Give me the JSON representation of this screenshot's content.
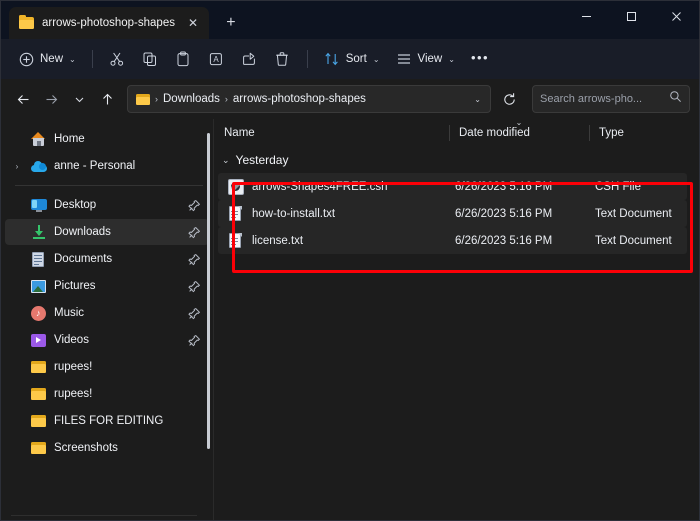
{
  "window": {
    "controls": {
      "minimize": "─",
      "maximize": "□",
      "close": "✕"
    }
  },
  "tabbar": {
    "tabs": [
      {
        "title": "arrows-photoshop-shapes",
        "close_label": "✕"
      }
    ],
    "new_tab_label": "+"
  },
  "toolbar": {
    "new_label": "New",
    "new_plus": "⊕",
    "cut_label": "Cut",
    "copy_label": "Copy",
    "paste_label": "Paste",
    "rename_label": "Rename",
    "share_label": "Share",
    "delete_label": "Delete",
    "sort_label": "Sort",
    "view_label": "View",
    "more_label": "•••",
    "chevron": "⌄"
  },
  "addressbar": {
    "back": "←",
    "forward": "→",
    "recent": "⌄",
    "up": "↑",
    "crumbs": [
      "Downloads",
      "arrows-photoshop-shapes"
    ],
    "separator": "›",
    "dropdown": "⌄",
    "refresh": "↻"
  },
  "search": {
    "placeholder": "Search arrows-pho...",
    "icon": "search-icon"
  },
  "sidebar": {
    "items": [
      {
        "label": "Home",
        "icon": "home-icon",
        "pinned": false,
        "expandable": false,
        "selected": false
      },
      {
        "label": "anne - Personal",
        "icon": "onedrive-cloud-icon",
        "pinned": false,
        "expandable": true,
        "selected": false
      },
      {
        "label": "Desktop",
        "icon": "desktop-icon",
        "pinned": true,
        "expandable": false,
        "selected": false
      },
      {
        "label": "Downloads",
        "icon": "downloads-icon",
        "pinned": true,
        "expandable": false,
        "selected": true
      },
      {
        "label": "Documents",
        "icon": "documents-icon",
        "pinned": true,
        "expandable": false,
        "selected": false
      },
      {
        "label": "Pictures",
        "icon": "pictures-icon",
        "pinned": true,
        "expandable": false,
        "selected": false
      },
      {
        "label": "Music",
        "icon": "music-icon",
        "pinned": true,
        "expandable": false,
        "selected": false
      },
      {
        "label": "Videos",
        "icon": "videos-icon",
        "pinned": true,
        "expandable": false,
        "selected": false
      },
      {
        "label": "rupees!",
        "icon": "folder-icon",
        "pinned": false,
        "expandable": false,
        "selected": false
      },
      {
        "label": "rupees!",
        "icon": "folder-icon",
        "pinned": false,
        "expandable": false,
        "selected": false
      },
      {
        "label": "FILES FOR EDITING",
        "icon": "folder-icon",
        "pinned": false,
        "expandable": false,
        "selected": false
      },
      {
        "label": "Screenshots",
        "icon": "folder-icon",
        "pinned": false,
        "expandable": false,
        "selected": false
      }
    ],
    "expand_chevron": "›"
  },
  "filelist": {
    "columns": {
      "name": "Name",
      "date_modified": "Date modified",
      "type": "Type"
    },
    "sort_indicator": "⌄",
    "group": {
      "label": "Yesterday",
      "chevron": "⌄"
    },
    "rows": [
      {
        "name": "arrows-Shapes4FREE.csh",
        "date": "6/26/2023 5:16 PM",
        "type": "CSH File",
        "icon": "csh-file-icon"
      },
      {
        "name": "how-to-install.txt",
        "date": "6/26/2023 5:16 PM",
        "type": "Text Document",
        "icon": "text-file-icon"
      },
      {
        "name": "license.txt",
        "date": "6/26/2023 5:16 PM",
        "type": "Text Document",
        "icon": "text-file-icon"
      }
    ]
  },
  "annotation": {
    "color": "#fb0007",
    "shape": "rectangle"
  },
  "colors": {
    "titlebar": "#0d1320",
    "toolbar": "#191d28",
    "content_bg": "#1c1c1c",
    "row_highlight": "#262626",
    "accent_folder": "#fdc949",
    "annotation_red": "#fb0007"
  }
}
